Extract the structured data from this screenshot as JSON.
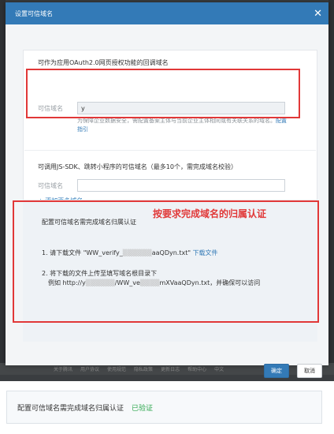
{
  "dialog": {
    "title": "设置可信域名",
    "close_icon": "close-icon"
  },
  "oauth": {
    "title": "可作为应用OAuth2.0网页授权功能的回调域名",
    "label": "可信域名",
    "value": "y",
    "hint": "为保障企业数据安全，需配置备案主体与当前企业主体相同或有关联关系的域名。",
    "hint_link": "配置指引"
  },
  "jssdk": {
    "title": "可调用JS-SDK、跳转小程序的可信域名（最多10个，需完成域名校验）",
    "label": "可信域名",
    "value": "",
    "add_more": "+ 添加更多域名"
  },
  "verify": {
    "annotation": "按要求完成域名的归属认证",
    "title": "配置可信域名需完成域名归属认证",
    "step1_text": "1. 请下载文件 \"WW_verify_",
    "step1_mid": "aaQDyn.txt\"",
    "step1_link": "下载文件",
    "step2_line1": "2. 将下载的文件上传至填写域名根目录下",
    "step2_line2": "例如 http://y",
    "step2_mid": "/WW_ve",
    "step2_tail": "mXVaaQDyn.txt，并确保可以访问"
  },
  "buttons": {
    "ok": "确定",
    "cancel": "取消"
  },
  "status": {
    "text": "配置可信域名需完成域名归属认证",
    "badge": "已验证",
    "badge_color": "#2fa84f"
  },
  "footer": [
    "关于腾讯",
    "用户协议",
    "使用规范",
    "隐私政策",
    "更新日志",
    "帮助中心",
    "中文"
  ]
}
